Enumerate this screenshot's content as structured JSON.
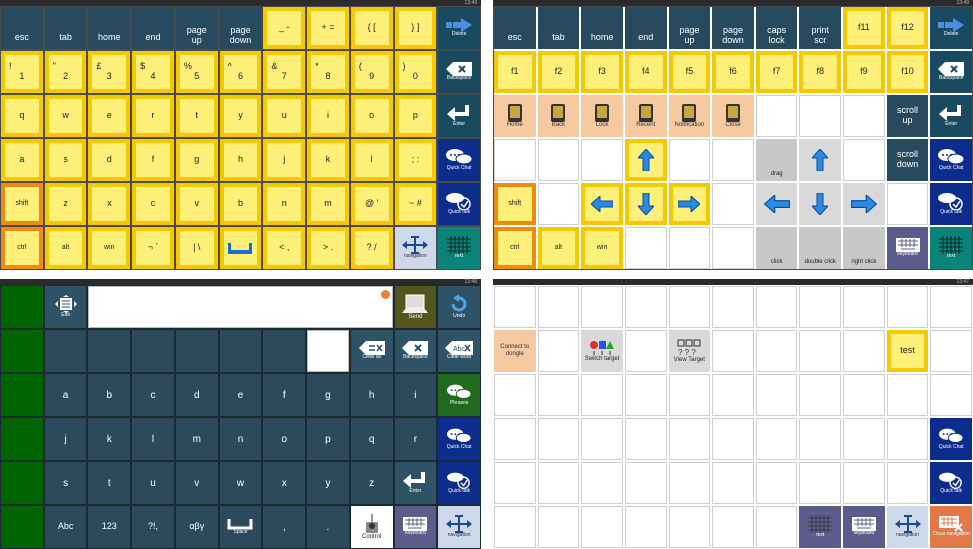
{
  "status": {
    "tr": "13:49",
    "tl": "13:49",
    "bl": "13:48",
    "br": "13:47"
  },
  "kb1": {
    "r1": [
      "esc",
      "tab",
      "home",
      "end",
      "page up",
      "page down",
      "_ -",
      "+ =",
      "{ [",
      "} ]"
    ],
    "r1_delete": "Delete",
    "r2": [
      [
        "!",
        "1"
      ],
      [
        "\"",
        "2"
      ],
      [
        "£",
        "3"
      ],
      [
        "$",
        "4"
      ],
      [
        "%",
        "5"
      ],
      [
        "^",
        "6"
      ],
      [
        "&",
        "7"
      ],
      [
        "*",
        "8"
      ],
      [
        "(",
        "9"
      ],
      [
        ")",
        "0"
      ]
    ],
    "r2_backspace": "Backspace",
    "r3": [
      "q",
      "w",
      "e",
      "r",
      "t",
      "y",
      "u",
      "i",
      "o",
      "p"
    ],
    "r3_enter": "Enter",
    "r4": [
      "a",
      "s",
      "d",
      "f",
      "g",
      "h",
      "j",
      "k",
      "l",
      "; :"
    ],
    "r4_quickchat": "Quick Chat",
    "r5": [
      "shift",
      "z",
      "x",
      "c",
      "v",
      "b",
      "n",
      "m",
      "@ '",
      "~ #"
    ],
    "r5_quicktalk": "Quick talk",
    "r6": [
      "ctrl",
      "alt",
      "win",
      "¬ `",
      "| \\",
      "",
      "< ,",
      "> .",
      "? /"
    ],
    "r6_navigation": "navigation",
    "r6_text": "text"
  },
  "kb2": {
    "r1": [
      "esc",
      "tab",
      "home",
      "end",
      "page up",
      "page down",
      "caps lock",
      "print scr",
      "f11",
      "f12"
    ],
    "r1_delete": "Delete",
    "r2": [
      "f1",
      "f2",
      "f3",
      "f4",
      "f5",
      "f6",
      "f7",
      "f8",
      "f9",
      "f10"
    ],
    "r2_backspace": "Backspace",
    "r3_apps": [
      "Home",
      "Back",
      "Lock",
      "Recent",
      "Notification",
      "Close"
    ],
    "scroll_up": "scroll up",
    "r3_enter": "Enter",
    "drag": "drag",
    "scroll_down": "scroll down",
    "r4_quickchat": "Quick Chat",
    "shift": "shift",
    "r5_quicktalk": "Quick talk",
    "r6": [
      "ctrl",
      "alt",
      "win"
    ],
    "click": "click",
    "double_click": "double click",
    "right_click": "right click",
    "keyboard": "keyboard",
    "text": "text"
  },
  "kb3": {
    "edit": "Edit",
    "send": "Send",
    "undo": "Undo",
    "clear_all": "Clear all",
    "backspace": "Backspace",
    "clear_word": "Clear word",
    "clear_word_icon_text": "Abc",
    "r3": [
      "a",
      "b",
      "c",
      "d",
      "e",
      "f",
      "g",
      "h",
      "i"
    ],
    "phrases": "Phrases",
    "r4": [
      "j",
      "k",
      "l",
      "m",
      "n",
      "o",
      "p",
      "q",
      "r"
    ],
    "quick_chat": "Quick Chat",
    "r5": [
      "s",
      "t",
      "u",
      "v",
      "w",
      "x",
      "y",
      "z"
    ],
    "enter": "Enter",
    "quick_talk": "Quick talk",
    "r6": [
      "Abc",
      "123",
      "?!,",
      "αβγ"
    ],
    "space": "Space",
    "comma": ",",
    "period": ".",
    "control": "Control",
    "keyboard": "keyboard",
    "navigation": "navigation"
  },
  "kb4": {
    "connect": "Connect to dongle",
    "switch_target": "Switch target",
    "view_target": "View Target",
    "view_target_icon_text": "? ? ?",
    "test": "test",
    "quick_chat": "Quick Chat",
    "quick_talk": "Quick talk",
    "text": "text",
    "keyboard": "keyboard",
    "navigation": "navigation",
    "close_navigation": "Close navigation"
  }
}
